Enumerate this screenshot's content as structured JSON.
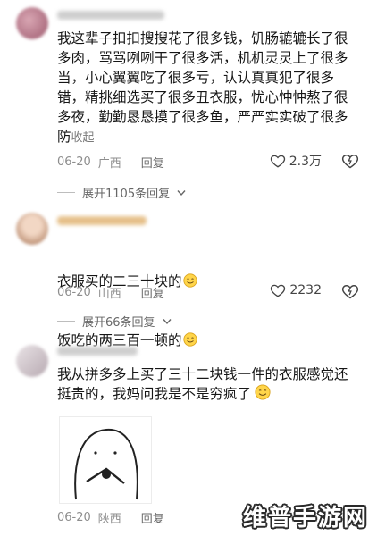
{
  "comments": [
    {
      "text": "我这辈子扣扣搜搜花了很多钱，饥肠辘辘长了很多肉，骂骂咧咧干了很多活，机机灵灵上了很多当，小心翼翼吃了很多亏，认认真真犯了很多错，精挑细选买了很多丑衣服，忧心忡忡熬了很多夜，勤勤恳恳摸了很多鱼，严严实实破了很多防",
      "collapse_label": "收起",
      "date": "06-20",
      "location": "广西",
      "reply_label": "回复",
      "likes": "2.3万",
      "expand_label": "展开1105条回复"
    },
    {
      "line1": "衣服买的二三十块的",
      "line2": "饭吃的两三百一顿的",
      "date": "06-20",
      "location": "山西",
      "reply_label": "回复",
      "likes": "2232",
      "expand_label": "展开66条回复"
    },
    {
      "text": "我从拼多多上买了三十二块钱一件的衣服感觉还挺贵的，我妈问我是不是穷疯了",
      "date": "06-20",
      "location": "陕西",
      "reply_label": "回复"
    }
  ],
  "watermark": "维普手游网",
  "colors": {
    "meta": "#8e8e8e",
    "text": "#161616",
    "watermark_outline": "#2a2a2a"
  },
  "icons": [
    "heart-icon",
    "dislike-icon",
    "chevron-down-icon",
    "emoji-smile-icon"
  ]
}
